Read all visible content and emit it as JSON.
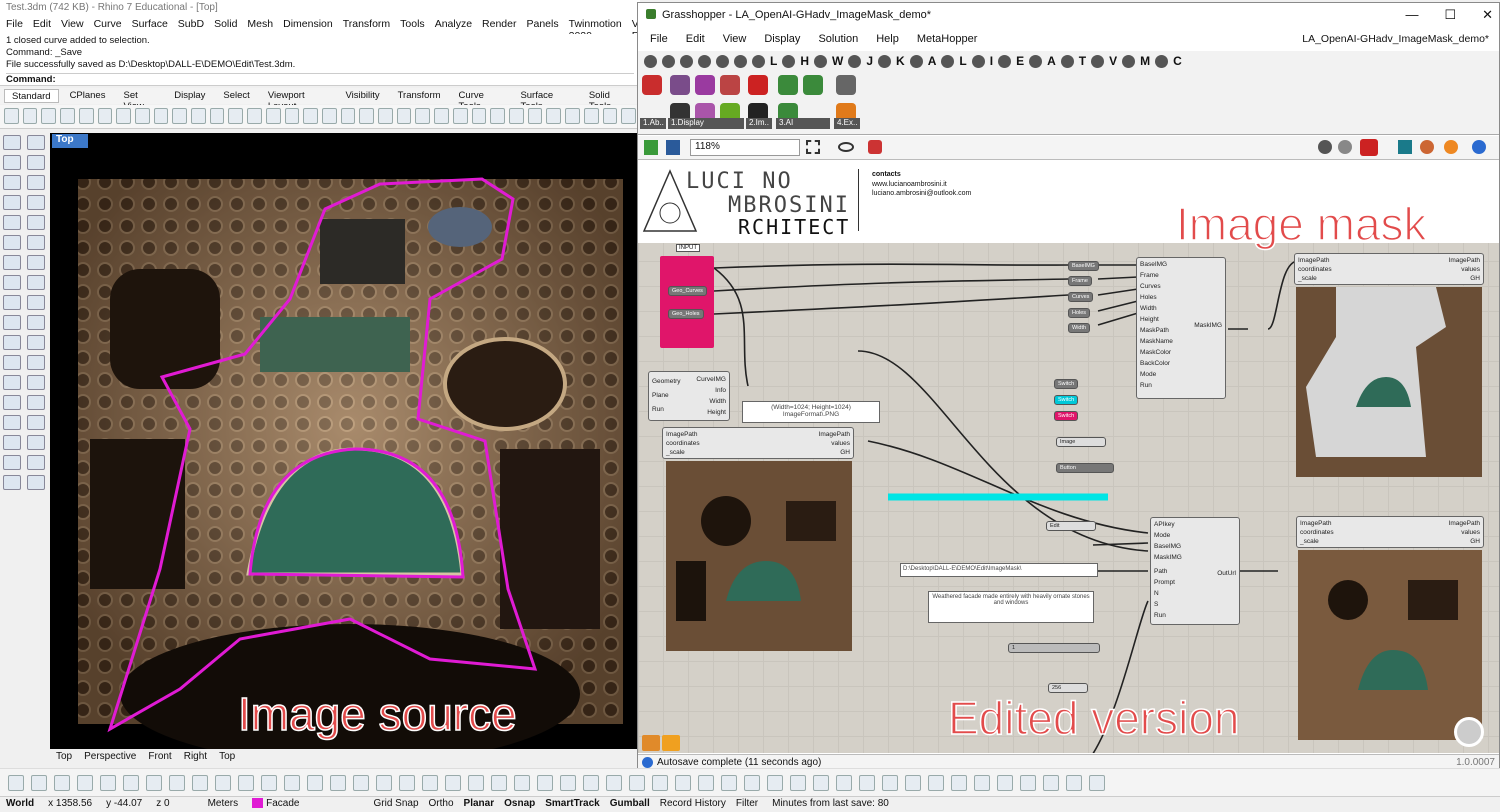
{
  "rhino": {
    "title": "Test.3dm (742 KB) - Rhino 7 Educational - [Top]",
    "menu": [
      "File",
      "Edit",
      "View",
      "Curve",
      "Surface",
      "SubD",
      "Solid",
      "Mesh",
      "Dimension",
      "Transform",
      "Tools",
      "Analyze",
      "Render",
      "Panels",
      "Twinmotion 2020",
      "V-Ray"
    ],
    "command_history": [
      "1 closed curve added to selection.",
      "Command: _Save",
      "File successfully saved as D:\\Desktop\\DALL-E\\DEMO\\Edit\\Test.3dm."
    ],
    "command_prompt": "Command:",
    "tabs": [
      "Standard",
      "CPlanes",
      "Set View",
      "Display",
      "Select",
      "Viewport Layout",
      "Visibility",
      "Transform",
      "Curve Tools",
      "Surface Tools",
      "Solid Tools"
    ],
    "viewport_name": "Top",
    "viewport_tabs": [
      "Top",
      "Perspective",
      "Front",
      "Right",
      "Top"
    ],
    "source_label": "Image source"
  },
  "status": {
    "world": "World",
    "x": "x 1358.56",
    "y": "y -44.07",
    "z": "z 0",
    "units": "Meters",
    "layer": "Facade",
    "layer_color": "#e01bd4",
    "toggles": [
      "Grid Snap",
      "Ortho",
      "Planar",
      "Osnap",
      "SmartTrack",
      "Gumball",
      "Record History",
      "Filter"
    ],
    "save_info": "Minutes from last save: 80"
  },
  "gh": {
    "title": "Grasshopper - LA_OpenAI-GHadv_ImageMask_demo*",
    "menu": [
      "File",
      "Edit",
      "View",
      "Display",
      "Solution",
      "Help",
      "MetaHopper"
    ],
    "file_name": "LA_OpenAI-GHadv_ImageMask_demo*",
    "icon_letters": [
      "L",
      "H",
      "W",
      "J",
      "K",
      "A",
      "L",
      "I",
      "E",
      "A",
      "T",
      "V",
      "M",
      "C"
    ],
    "ribbon_groups": [
      "1.Ab..",
      "1.Display",
      "2.Im..",
      "3.AI",
      "4.Ex.."
    ],
    "zoom": "118%",
    "logo_line1": "LUCI NO",
    "logo_line2": "MBROSINI",
    "logo_line3": "RCHITECT",
    "contacts_title": "contacts",
    "contacts_web": "www.lucianoambrosini.it",
    "contacts_mail": "luciano.ambrosini@outlook.com",
    "mask_label": "Image mask",
    "edited_label": "Edited version",
    "autosave": "Autosave complete (11 seconds ago)",
    "version": "1.0.0007",
    "input_label": "INPUT",
    "pills_left": [
      "Geo_Curves",
      "Geo_Holes"
    ],
    "imagepath_inputs": [
      "ImagePath",
      "coordinates",
      "_scale"
    ],
    "imagepath_outputs": [
      "ImagePath",
      "values",
      "GH"
    ],
    "mask_inputs": [
      "BaseIMG",
      "Frame",
      "Curves",
      "Holes",
      "Width",
      "Height",
      "MaskPath",
      "MaskName",
      "MaskColor",
      "BackColor",
      "Mode",
      "Run"
    ],
    "mask_output": "MaskIMG",
    "openai_inputs": [
      "APIkey",
      "Mode",
      "BaseIMG",
      "MaskIMG",
      "Path",
      "Prompt",
      "N",
      "S",
      "Run"
    ],
    "openai_output": "OutUrl",
    "size_text": "(Width=1024; Height=1024) ImageFormat\\.PNG",
    "folder_text": "D:\\Desktop\\DALL-E\\DEMO\\Edit\\ImageMask\\",
    "prompt_text": "Weathered facade made entirely with heavily ornate stones and windows",
    "base_pills": [
      "BaseIMG",
      "Frame",
      "Curves",
      "Holes",
      "Width"
    ],
    "switches": [
      "Switch",
      "Switch",
      "Switch"
    ],
    "dropdowns": [
      "Image",
      "Edit",
      "256"
    ],
    "button_label": "Button",
    "panel_value": "1",
    "geometry_inputs": [
      "Geometry",
      "Plane",
      "Run"
    ],
    "geometry_outputs": [
      "CurveIMG",
      "Info",
      "Width",
      "Height"
    ]
  }
}
